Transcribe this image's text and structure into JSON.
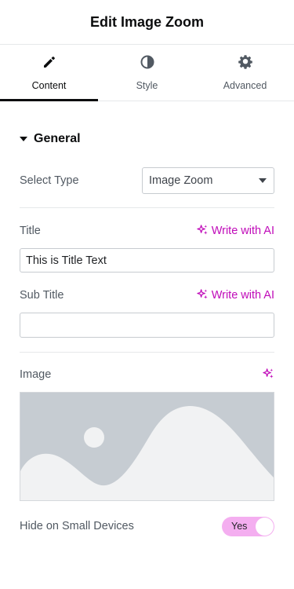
{
  "header": {
    "title": "Edit Image Zoom"
  },
  "tabs": [
    {
      "label": "Content",
      "icon": "pencil-icon",
      "active": true
    },
    {
      "label": "Style",
      "icon": "contrast-icon",
      "active": false
    },
    {
      "label": "Advanced",
      "icon": "gear-icon",
      "active": false
    }
  ],
  "section": {
    "title": "General"
  },
  "select_type": {
    "label": "Select Type",
    "value": "Image Zoom"
  },
  "title_field": {
    "label": "Title",
    "ai_label": "Write with AI",
    "value": "This is Title Text",
    "placeholder": ""
  },
  "subtitle_field": {
    "label": "Sub Title",
    "ai_label": "Write with AI",
    "value": "",
    "placeholder": ""
  },
  "image_field": {
    "label": "Image"
  },
  "hide_small": {
    "label": "Hide on Small Devices",
    "toggle_label": "Yes",
    "enabled": true
  },
  "colors": {
    "accent": "#c00bb9",
    "toggle_bg": "#f4aef0",
    "placeholder_bg": "#c6ccd2"
  }
}
